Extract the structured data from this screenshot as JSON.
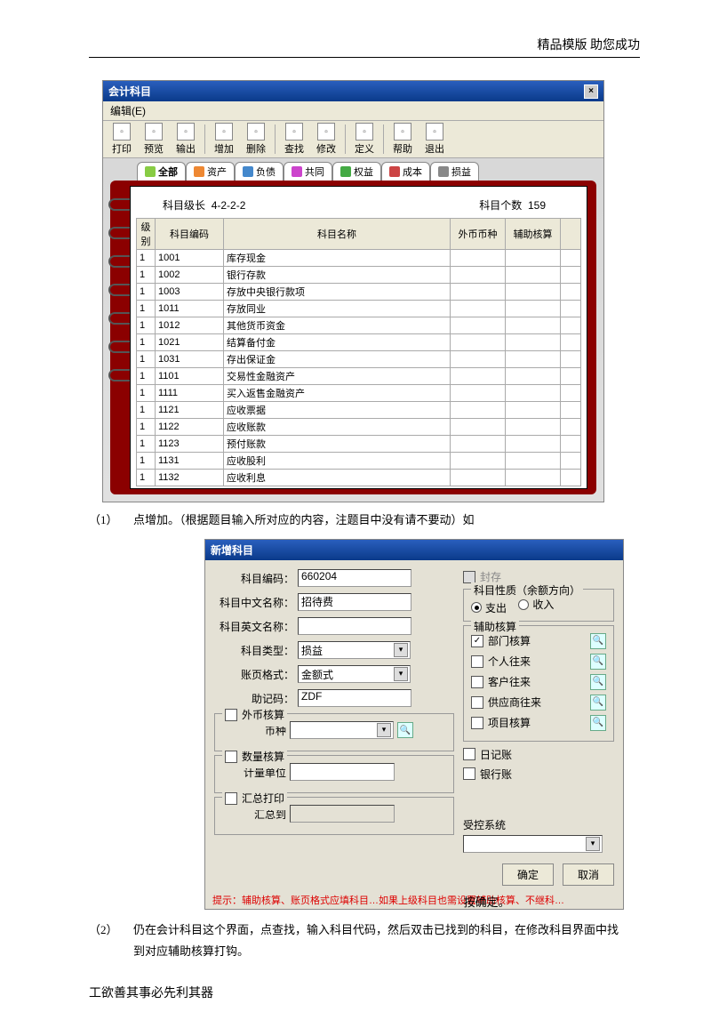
{
  "doc": {
    "header": "精品模版 助您成功",
    "footer": "工欲善其事必先利其器",
    "instr1_num": "（1）",
    "instr1": "点增加。（根据题目输入所对应的内容，注题目中没有请不要动）如",
    "instr_after": "按确定。",
    "instr2_num": "（2）",
    "instr2": "仍在会计科目这个界面，点查找，输入科目代码，然后双击已找到的科目，在修改科目界面中找到对应辅助核算打钩。"
  },
  "win1": {
    "title": "会计科目",
    "menu": "编辑(E)",
    "toolbar": [
      "打印",
      "预览",
      "输出",
      "增加",
      "删除",
      "查找",
      "修改",
      "定义",
      "帮助",
      "退出"
    ],
    "tabs": [
      "全部",
      "资产",
      "负债",
      "共同",
      "权益",
      "成本",
      "损益"
    ],
    "meta1_label": "科目级长",
    "meta1_val": "4-2-2-2",
    "meta2_label": "科目个数",
    "meta2_val": "159",
    "cols": [
      "级别",
      "科目编码",
      "科目名称",
      "外币币种",
      "辅助核算",
      ""
    ],
    "rows": [
      {
        "l": "1",
        "c": "1001",
        "n": "库存现金"
      },
      {
        "l": "1",
        "c": "1002",
        "n": "银行存款"
      },
      {
        "l": "1",
        "c": "1003",
        "n": "存放中央银行款项"
      },
      {
        "l": "1",
        "c": "1011",
        "n": "存放同业"
      },
      {
        "l": "1",
        "c": "1012",
        "n": "其他货币资金"
      },
      {
        "l": "1",
        "c": "1021",
        "n": "结算备付金"
      },
      {
        "l": "1",
        "c": "1031",
        "n": "存出保证金"
      },
      {
        "l": "1",
        "c": "1101",
        "n": "交易性金融资产"
      },
      {
        "l": "1",
        "c": "1111",
        "n": "买入返售金融资产"
      },
      {
        "l": "1",
        "c": "1121",
        "n": "应收票据"
      },
      {
        "l": "1",
        "c": "1122",
        "n": "应收账款"
      },
      {
        "l": "1",
        "c": "1123",
        "n": "预付账款"
      },
      {
        "l": "1",
        "c": "1131",
        "n": "应收股利"
      },
      {
        "l": "1",
        "c": "1132",
        "n": "应收利息"
      }
    ]
  },
  "win2": {
    "title": "新增科目",
    "labels": {
      "code": "科目编码：",
      "code_val": "660204",
      "cname": "科目中文名称：",
      "cname_val": "招待费",
      "ename": "科目英文名称：",
      "type": "科目类型：",
      "type_val": "损益",
      "page": "账页格式：",
      "page_val": "金额式",
      "mnem": "助记码：",
      "mnem_val": "ZDF",
      "seal": "封存",
      "nature_box": "科目性质（余额方向）",
      "out": "支出",
      "in": "收入",
      "aux_box": "辅助核算",
      "aux": [
        "部门核算",
        "个人往来",
        "客户往来",
        "供应商往来",
        "项目核算"
      ],
      "fc_box": "外币核算",
      "fc_label": "币种",
      "qty_box": "数量核算",
      "qty_label": "计量单位",
      "sum_box": "汇总打印",
      "sum_label": "汇总到",
      "diary": "日记账",
      "bank": "银行账",
      "sys_label": "受控系统",
      "ok": "确定",
      "cancel": "取消",
      "hint": "提示：辅助核算、账页格式应填科目…如果上级科目也需设置辅助核算、不继科…"
    }
  }
}
